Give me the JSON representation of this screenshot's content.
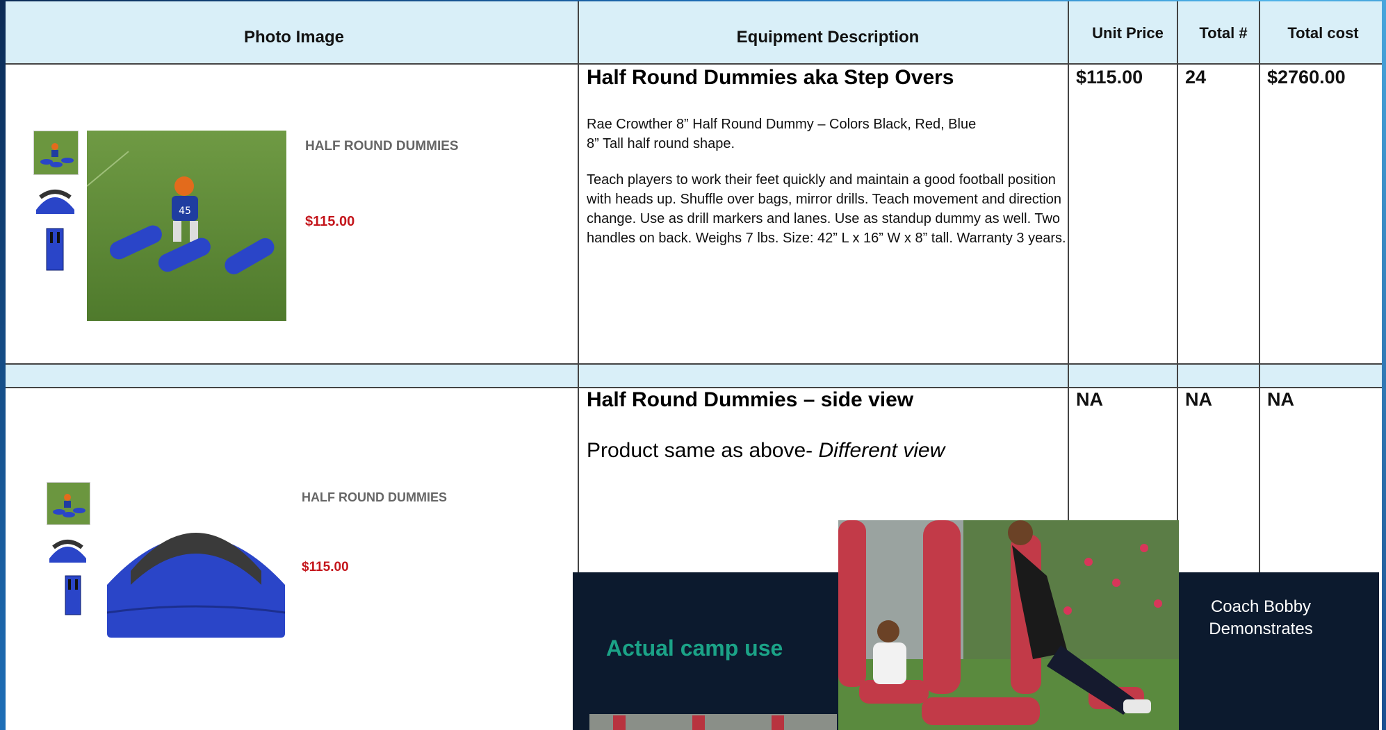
{
  "header": {
    "photo": "Photo Image",
    "equipment": "Equipment   Description",
    "unit_price": "Unit Price",
    "total_num": "Total #",
    "total_cost": "Total cost"
  },
  "rows": [
    {
      "title": "Half Round Dummies aka Step Overs",
      "desc_line1": "Rae Crowther 8” Half Round Dummy – Colors Black, Red, Blue",
      "desc_line2": "8” Tall half round shape.",
      "desc_para": "Teach players to work their feet quickly and maintain a good football position with heads up. Shuffle over bags, mirror drills. Teach movement and direction change. Use as drill markers and lanes. Use as standup dummy as well. Two handles on back. Weighs 7 lbs. Size: 42” L x 16” W x 8” tall. Warranty 3 years.",
      "unit_price": "$115.00",
      "total_num": "24",
      "total_cost": "$2760.00",
      "product_name": "HALF ROUND DUMMIES",
      "product_price": "$115.00"
    },
    {
      "title": "Half Round Dummies – side view",
      "desc_plain": "Product same as above- ",
      "desc_italic": "Different view",
      "unit_price": "NA",
      "total_num": "NA",
      "total_cost": "NA",
      "product_name": "HALF ROUND DUMMIES",
      "product_price": "$115.00"
    }
  ],
  "overlay": {
    "camp_label": "Actual camp use",
    "coach_label_line1": "Coach Bobby",
    "coach_label_line2": "Demonstrates"
  },
  "colors": {
    "header_bg": "#d9eff8",
    "price_red": "#c4161c",
    "camp_green": "#1ba387",
    "overlay_bg": "#0c1a2e",
    "dummy_blue": "#2a45c8"
  }
}
